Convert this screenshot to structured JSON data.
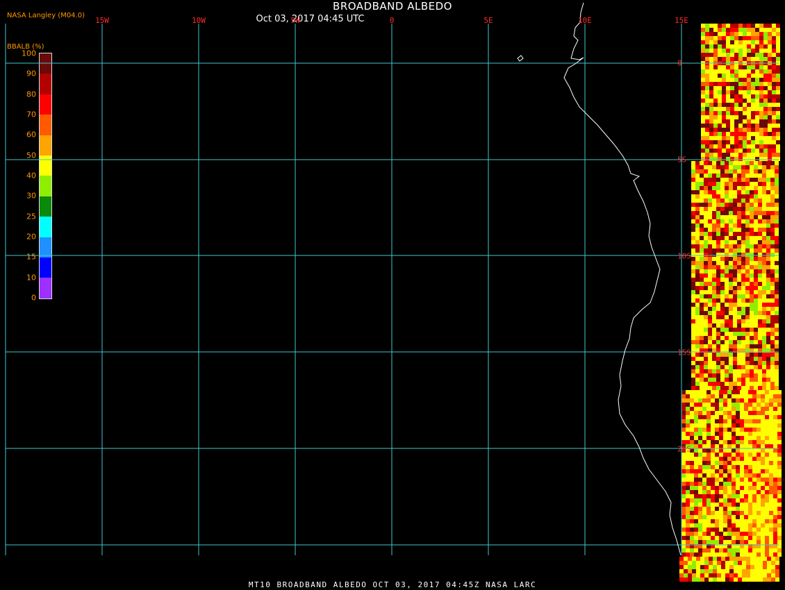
{
  "header": {
    "title": "BROADBAND ALBEDO",
    "subtitle": "Oct 03, 2017 04:45 UTC",
    "credit": "NASA Langley (M04.0)"
  },
  "colorbar": {
    "title": "BBALB (%)",
    "ticks": [
      "100",
      "90",
      "80",
      "70",
      "60",
      "50",
      "40",
      "30",
      "25",
      "20",
      "15",
      "10",
      "0"
    ],
    "colors": [
      "#6b0a0a",
      "#b30000",
      "#ff0000",
      "#ff5a00",
      "#ffa500",
      "#ffff00",
      "#90ee00",
      "#0a8a0a",
      "#00ffff",
      "#1e90ff",
      "#0000ff",
      "#9b30ff"
    ]
  },
  "map": {
    "lon_labels": [
      "15W",
      "10W",
      "5W",
      "0",
      "5E",
      "10E",
      "15E"
    ],
    "lat_labels": [
      "0",
      "5S",
      "10S",
      "15S",
      "20S"
    ],
    "grid_color": "#40c8d0",
    "coast_color": "#ffffff"
  },
  "footer": {
    "text": "MT10  BROADBAND ALBEDO   OCT 03, 2017 04:45Z   NASA LARC"
  }
}
